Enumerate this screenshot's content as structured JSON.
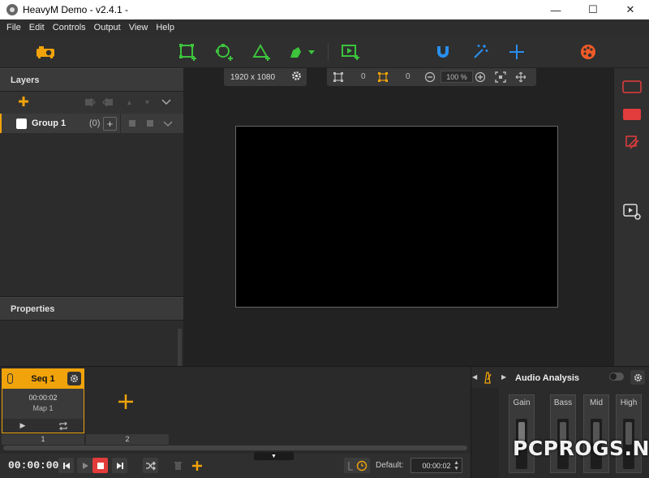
{
  "window": {
    "title": "HeavyM Demo - v2.4.1 -",
    "minimize": "—",
    "maximize": "☐",
    "close": "✕"
  },
  "menu": [
    "File",
    "Edit",
    "Controls",
    "Output",
    "View",
    "Help"
  ],
  "toolbar": {
    "icons": [
      "projector-icon",
      "rect-add-icon",
      "circle-add-icon",
      "triangle-add-icon",
      "pen-tool-icon",
      "media-add-icon",
      "magnet-icon",
      "magic-wand-icon",
      "crosshair-icon",
      "palette-icon"
    ],
    "accent_green": "#3cc43c",
    "accent_blue": "#2a8ff0",
    "accent_orange": "#f0a30a",
    "accent_red": "#e23c3c"
  },
  "layers": {
    "title": "Layers",
    "group": {
      "label": "Group 1",
      "count": "(0)",
      "add": "+"
    }
  },
  "properties": {
    "title": "Properties"
  },
  "canvas": {
    "resolution": "1920 x 1080",
    "width_val": "0",
    "height_val": "0",
    "zoom": "100 %"
  },
  "sequence": {
    "name": "Seq 1",
    "time": "00:00:02",
    "map": "Map 1",
    "tabs": [
      "1",
      "2"
    ]
  },
  "transport": {
    "timecode": "00:00:00",
    "default_label": "Default:",
    "default_value": "00:00:02"
  },
  "audio": {
    "title": "Audio Analysis",
    "bands": [
      "Gain",
      "Bass",
      "Mid",
      "High"
    ]
  },
  "watermark": "PCPROGS.NET"
}
